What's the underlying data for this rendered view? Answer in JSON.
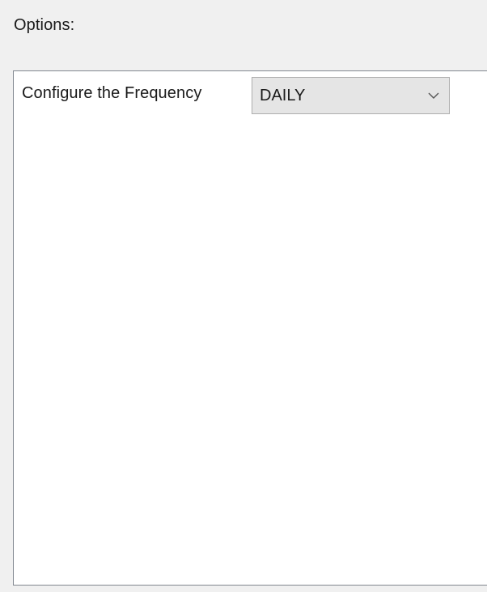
{
  "options": {
    "label": "Options:"
  },
  "frequency": {
    "label": "Configure the Frequency",
    "selected": "DAILY"
  },
  "icons": {
    "dropdown": "chevron-down-icon"
  }
}
